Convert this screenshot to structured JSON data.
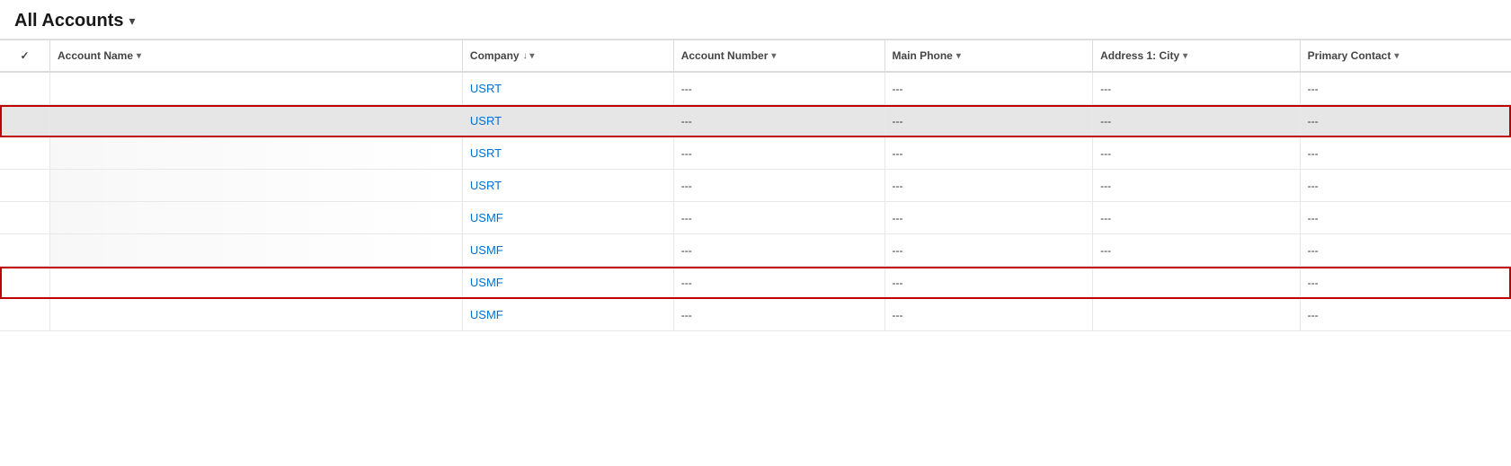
{
  "header": {
    "title": "All Accounts",
    "chevron": "▾"
  },
  "columns": [
    {
      "id": "check",
      "label": "✓",
      "sortable": false
    },
    {
      "id": "account-name",
      "label": "Account Name",
      "sort": "▾",
      "border_left": false
    },
    {
      "id": "company",
      "label": "Company",
      "sort": "↓ ▾"
    },
    {
      "id": "account-number",
      "label": "Account Number",
      "sort": "▾"
    },
    {
      "id": "main-phone",
      "label": "Main Phone",
      "sort": "▾"
    },
    {
      "id": "address-city",
      "label": "Address 1: City",
      "sort": "▾"
    },
    {
      "id": "primary-contact",
      "label": "Primary Contact",
      "sort": "▾"
    }
  ],
  "rows": [
    {
      "id": 1,
      "account_name": "",
      "company": "USRT",
      "account_number": "---",
      "main_phone": "---",
      "address_city": "---",
      "primary_contact": "---",
      "style": "normal"
    },
    {
      "id": 2,
      "account_name": "",
      "company": "USRT",
      "account_number": "---",
      "main_phone": "---",
      "address_city": "---",
      "primary_contact": "---",
      "style": "highlighted-red"
    },
    {
      "id": 3,
      "account_name": "",
      "company": "USRT",
      "account_number": "---",
      "main_phone": "---",
      "address_city": "---",
      "primary_contact": "---",
      "style": "partial"
    },
    {
      "id": 4,
      "account_name": "",
      "company": "USRT",
      "account_number": "---",
      "main_phone": "---",
      "address_city": "---",
      "primary_contact": "---",
      "style": "partial"
    },
    {
      "id": 5,
      "account_name": "",
      "company": "USMF",
      "account_number": "---",
      "main_phone": "---",
      "address_city": "---",
      "primary_contact": "---",
      "style": "partial"
    },
    {
      "id": 6,
      "account_name": "",
      "company": "USMF",
      "account_number": "---",
      "main_phone": "---",
      "address_city": "---",
      "primary_contact": "---",
      "style": "partial"
    },
    {
      "id": 7,
      "account_name": "",
      "company": "USMF",
      "account_number": "---",
      "main_phone": "---",
      "address_city": "",
      "primary_contact": "---",
      "style": "outlined-red"
    },
    {
      "id": 8,
      "account_name": "",
      "company": "USMF",
      "account_number": "---",
      "main_phone": "---",
      "address_city": "",
      "primary_contact": "---",
      "style": "normal"
    }
  ],
  "empty": "---"
}
